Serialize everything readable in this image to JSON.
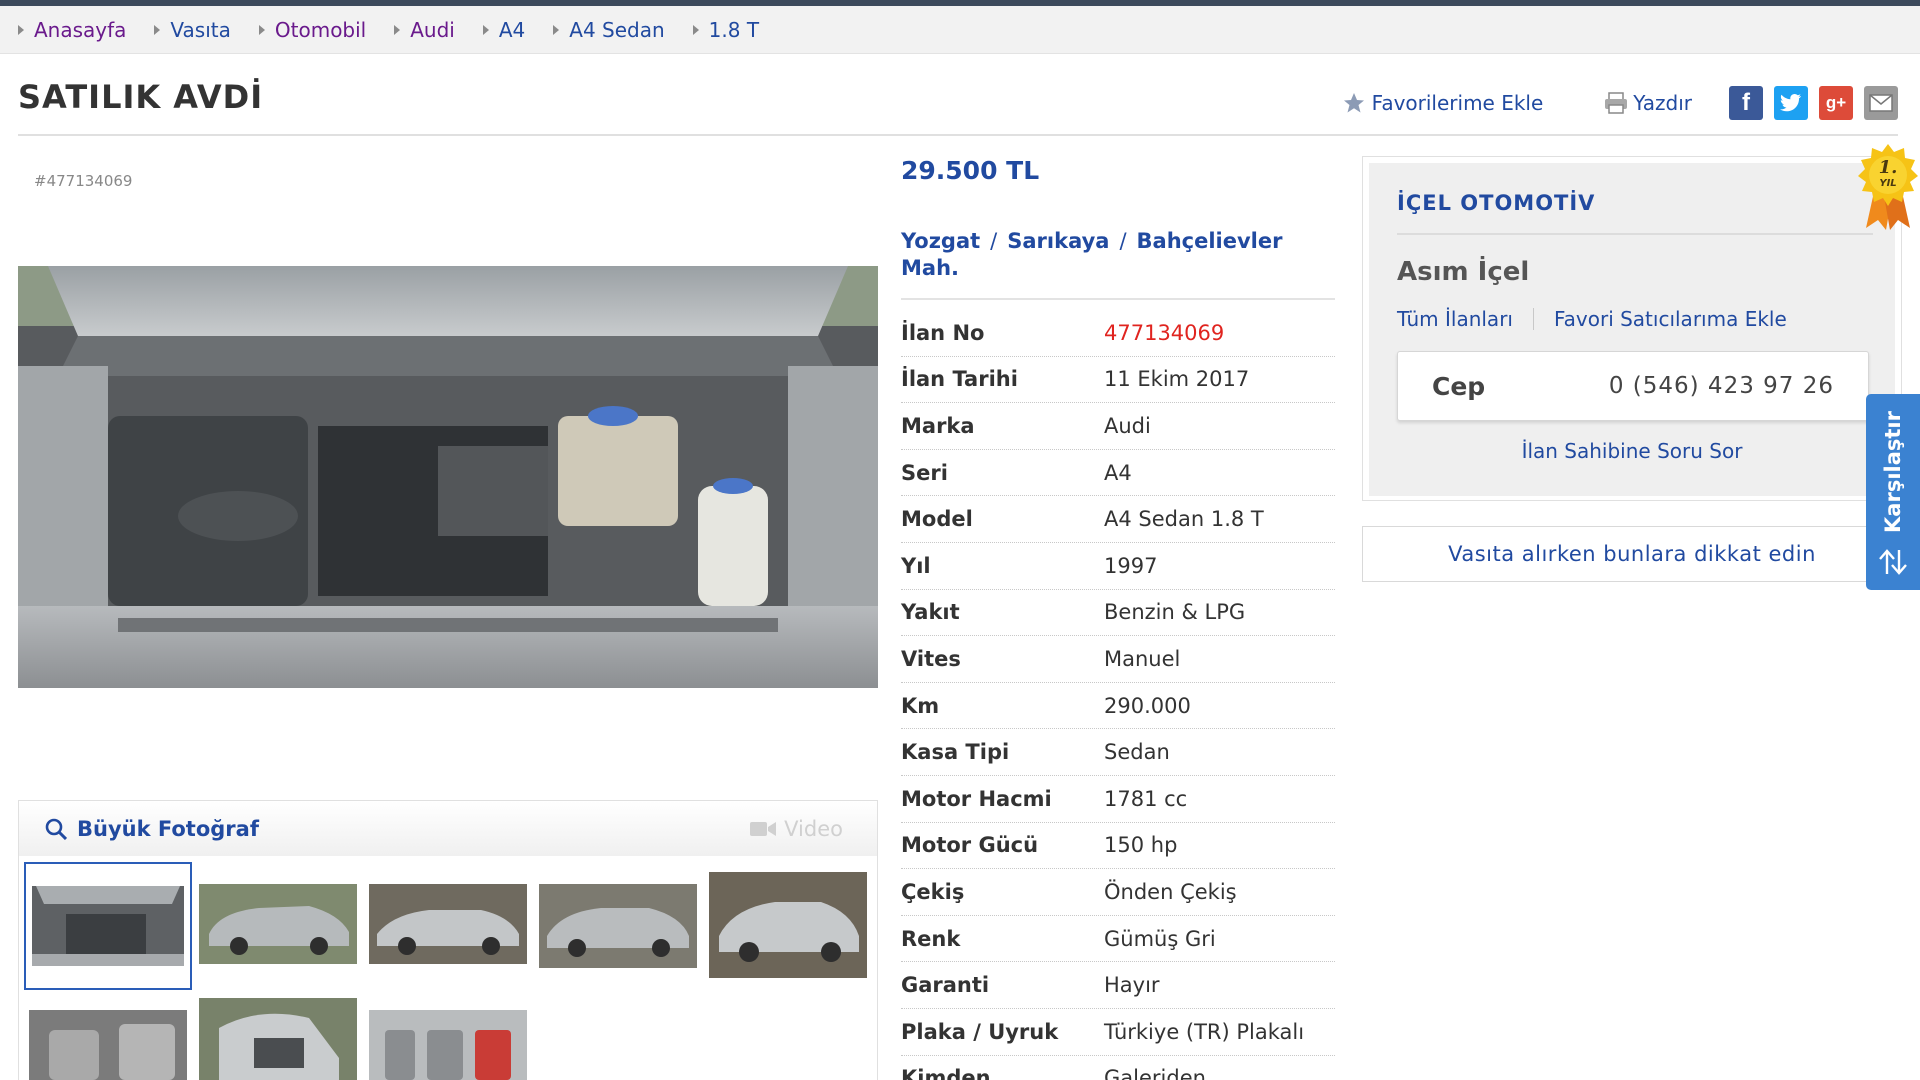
{
  "breadcrumb": [
    "Anasayfa",
    "Vasıta",
    "Otomobil",
    "Audi",
    "A4",
    "A4 Sedan",
    "1.8 T"
  ],
  "header": {
    "title": "SATILIK AVDİ",
    "favorite_label": "Favorilerime Ekle",
    "print_label": "Yazdır",
    "social": {
      "facebook": "f",
      "twitter": "t",
      "googleplus": "g+"
    }
  },
  "listing": {
    "id_text": "#477134069",
    "price": "29.500 TL",
    "location": {
      "city": "Yozgat",
      "district": "Sarıkaya",
      "neighborhood": "Bahçelievler Mah.",
      "separator": "/"
    },
    "specs": [
      {
        "label": "İlan No",
        "value": "477134069"
      },
      {
        "label": "İlan Tarihi",
        "value": "11 Ekim 2017"
      },
      {
        "label": "Marka",
        "value": "Audi"
      },
      {
        "label": "Seri",
        "value": "A4"
      },
      {
        "label": "Model",
        "value": "A4 Sedan 1.8 T"
      },
      {
        "label": "Yıl",
        "value": "1997"
      },
      {
        "label": "Yakıt",
        "value": "Benzin & LPG"
      },
      {
        "label": "Vites",
        "value": "Manuel"
      },
      {
        "label": "Km",
        "value": "290.000"
      },
      {
        "label": "Kasa Tipi",
        "value": "Sedan"
      },
      {
        "label": "Motor Hacmi",
        "value": "1781 cc"
      },
      {
        "label": "Motor Gücü",
        "value": "150 hp"
      },
      {
        "label": "Çekiş",
        "value": "Önden Çekiş"
      },
      {
        "label": "Renk",
        "value": "Gümüş Gri"
      },
      {
        "label": "Garanti",
        "value": "Hayır"
      },
      {
        "label": "Plaka / Uyruk",
        "value": "Türkiye (TR) Plakalı"
      },
      {
        "label": "Kimden",
        "value": "Galeriden"
      }
    ]
  },
  "gallery": {
    "big_photo_label": "Büyük Fotoğraf",
    "video_label": "Video"
  },
  "seller": {
    "store_name": "İÇEL OTOMOTİV",
    "name": "Asım İçel",
    "all_listings_label": "Tüm İlanları",
    "add_favorite_seller_label": "Favori Satıcılarıma Ekle",
    "phone_label": "Cep",
    "phone_number": "0 (546) 423 97 26",
    "ask_label": "İlan Sahibine Soru Sor",
    "badge": {
      "number": "1.",
      "text": "YIL"
    }
  },
  "advice_label": "Vasıta alırken bunlara dikkat edin",
  "compare_label": "Karşılaştır",
  "colors": {
    "link_blue": "#214aa0",
    "accent_red": "#e0241f",
    "compare_blue": "#3b82d1"
  }
}
